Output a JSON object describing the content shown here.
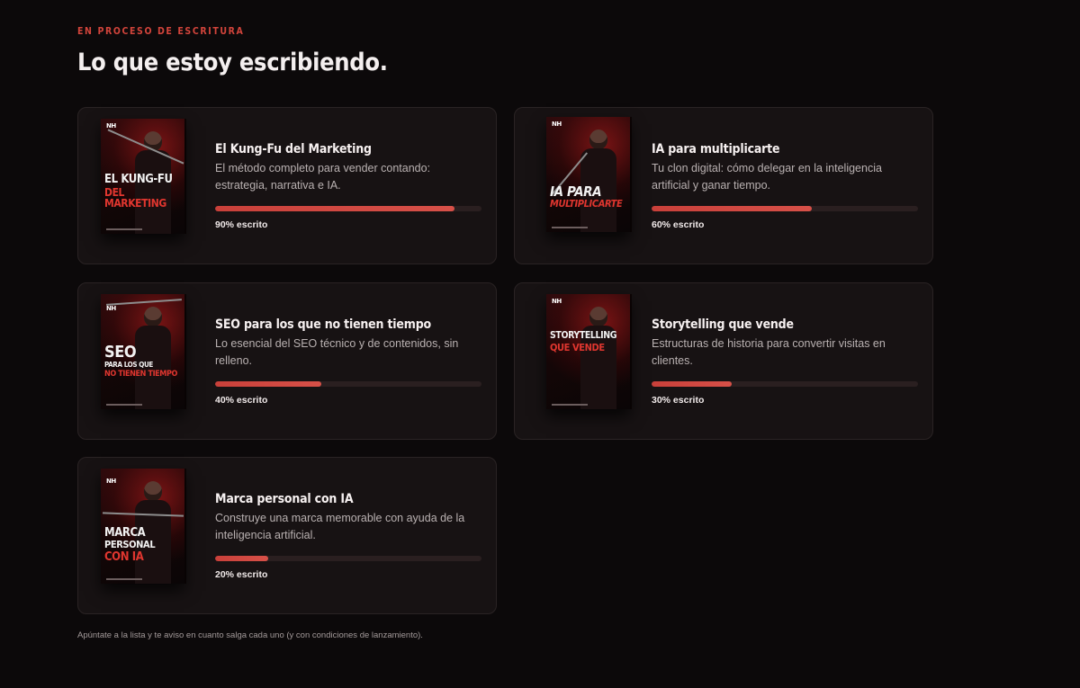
{
  "section": {
    "eyebrow": "EN PROCESO DE ESCRITURA",
    "title": "Lo que estoy escribiendo."
  },
  "books": [
    {
      "title": "El Kung-Fu del Marketing",
      "description": "El método completo para vender contando: estrategia, narrativa e IA.",
      "progress": 0.9,
      "progress_label": "90% escrito",
      "cover_brand": "NH",
      "cover_title": [
        "EL KUNG-FU",
        "DEL MARKETING"
      ]
    },
    {
      "title": "IA para multiplicarte",
      "description": "Tu clon digital: cómo delegar en la inteligencia artificial y ganar tiempo.",
      "progress": 0.6,
      "progress_label": "60% escrito",
      "cover_brand": "NH",
      "cover_title": [
        "IA PARA",
        "MULTIPLICARTE"
      ]
    },
    {
      "title": "SEO para los que no tienen tiempo",
      "description": "Lo esencial del SEO técnico y de contenidos, sin relleno.",
      "progress": 0.4,
      "progress_label": "40% escrito",
      "cover_brand": "NH",
      "cover_title": [
        "SEO",
        "PARA LOS QUE",
        "NO TIENEN TIEMPO"
      ]
    },
    {
      "title": "Storytelling que vende",
      "description": "Estructuras de historia para convertir visitas en clientes.",
      "progress": 0.3,
      "progress_label": "30% escrito",
      "cover_brand": "NH",
      "cover_title": [
        "STORYTELLING",
        "QUE VENDE"
      ]
    },
    {
      "title": "Marca personal con IA",
      "description": "Construye una marca memorable con ayuda de la inteligencia artificial.",
      "progress": 0.2,
      "progress_label": "20% escrito",
      "cover_brand": "NH",
      "cover_title": [
        "MARCA",
        "PERSONAL",
        "CON IA"
      ]
    }
  ],
  "footer_note": "Apúntate a la lista y te aviso en cuanto salga cada uno (y con condiciones de lanzamiento).",
  "colors": {
    "accent": "#d2443b",
    "background": "#0c090a",
    "card": "#171213"
  }
}
